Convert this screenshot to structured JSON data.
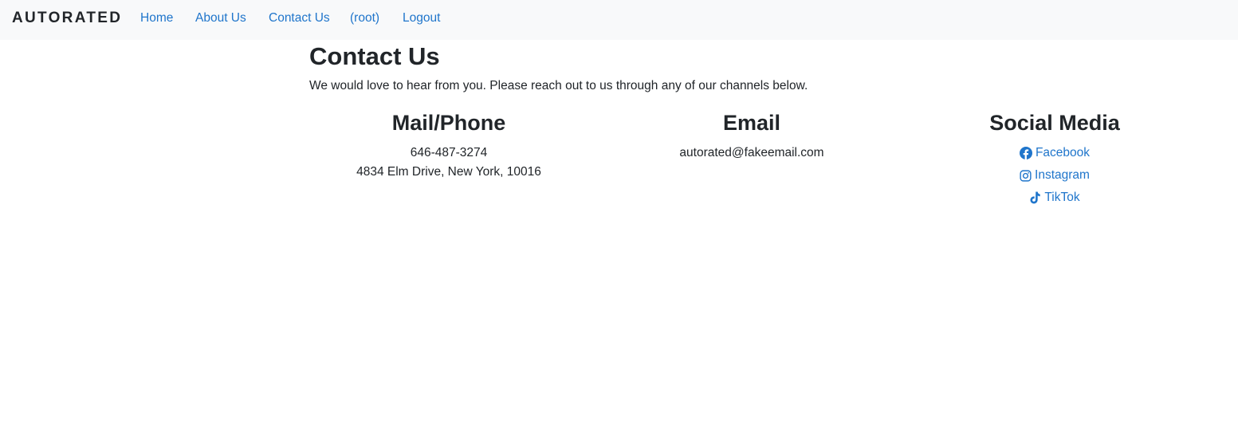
{
  "nav": {
    "brand": "AUTORATED",
    "links": [
      "Home",
      "About Us",
      "Contact Us",
      "(root)",
      "Logout"
    ],
    "link_color": "#1f75cb",
    "background": "#f8f9fa"
  },
  "main": {
    "title": "Contact Us",
    "intro": "We would love to hear from you. Please reach out to us through any of our channels below.",
    "mail_phone": {
      "heading": "Mail/Phone",
      "phone": "646-487-3274",
      "address": "4834 Elm Drive, New York, 10016"
    },
    "email": {
      "heading": "Email",
      "address": "autorated@fakeemail.com"
    },
    "social": {
      "heading": "Social Media",
      "items": [
        {
          "label": "Facebook",
          "icon": "facebook-icon"
        },
        {
          "label": "Instagram",
          "icon": "instagram-icon"
        },
        {
          "label": "TikTok",
          "icon": "tiktok-icon"
        }
      ]
    }
  }
}
